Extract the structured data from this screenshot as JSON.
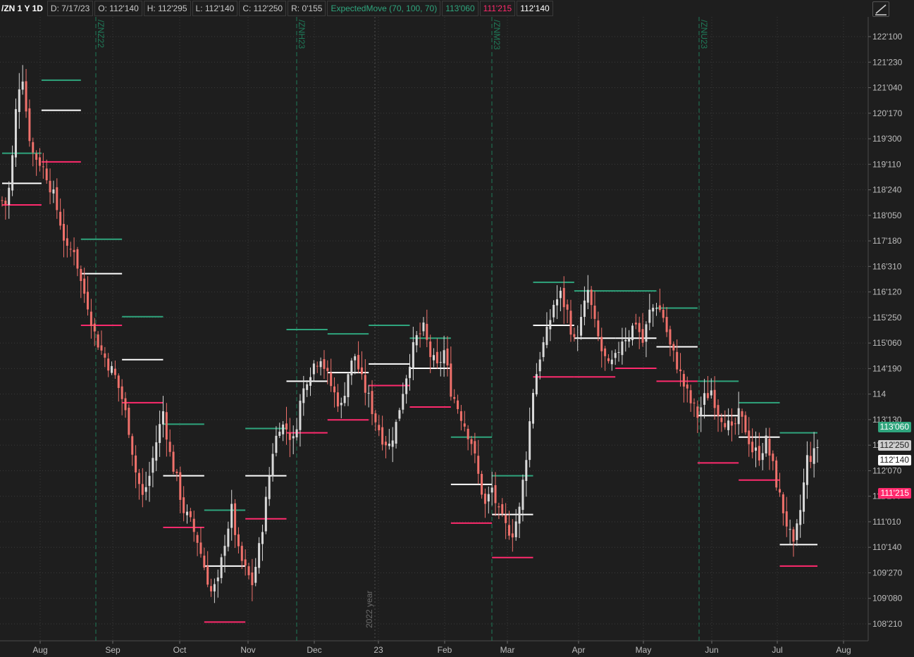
{
  "header": {
    "symbol": "/ZN 1 Y 1D",
    "date": "D: 7/17/23",
    "open": "O: 112'140",
    "high": "H: 112'295",
    "low": "L: 112'140",
    "close": "C: 112'250",
    "range": "R: 0'155",
    "study": "ExpectedMove (70, 100, 70)",
    "study_upper": "113'060",
    "study_lower": "111'215",
    "study_mid": "112'140"
  },
  "colors": {
    "background": "#1e1e1e",
    "grid": "#3a3a3a",
    "up_candle": "#d9d9d9",
    "down_candle": "#f0716b",
    "em_upper": "#2fa57d",
    "em_lower": "#ff2a6d",
    "em_mid": "#ffffff",
    "rollover_line": "#1f7a58"
  },
  "chart_data": {
    "type": "candlestick",
    "y_ticks": [
      "122'100",
      "121'230",
      "121'040",
      "120'170",
      "119'300",
      "119'110",
      "118'240",
      "118'050",
      "117'180",
      "116'310",
      "116'120",
      "115'250",
      "115'060",
      "114'190",
      "114",
      "113'130",
      "112'250",
      "112'070",
      "111'200",
      "111'010",
      "110'140",
      "109'270",
      "109'080",
      "108'210"
    ],
    "x_ticks": [
      "Aug",
      "Sep",
      "Oct",
      "Nov",
      "Dec",
      "23",
      "Feb",
      "Mar",
      "Apr",
      "May",
      "Jun",
      "Jul",
      "Aug"
    ],
    "rollovers": [
      "/ZNZ22",
      "/ZNH23",
      "/ZNM23",
      "/ZNU23"
    ],
    "year_marker": "2022 year",
    "price_tags": [
      {
        "label": "113'060",
        "kind": "em_upper"
      },
      {
        "label": "112'250",
        "kind": "close"
      },
      {
        "label": "112'140",
        "kind": "em_mid"
      },
      {
        "label": "111'215",
        "kind": "em_lower"
      }
    ],
    "anchors": [
      [
        0,
        118.5
      ],
      [
        3,
        118.4
      ],
      [
        6,
        119.5
      ],
      [
        9,
        121.1
      ],
      [
        12,
        121.4
      ],
      [
        15,
        120.2
      ],
      [
        18,
        119.6
      ],
      [
        22,
        119.4
      ],
      [
        26,
        119.1
      ],
      [
        30,
        118.6
      ],
      [
        34,
        118.0
      ],
      [
        38,
        117.3
      ],
      [
        42,
        117.4
      ],
      [
        46,
        116.6
      ],
      [
        50,
        116.1
      ],
      [
        54,
        115.4
      ],
      [
        58,
        115.0
      ],
      [
        62,
        114.7
      ],
      [
        66,
        114.4
      ],
      [
        70,
        113.9
      ],
      [
        74,
        113.2
      ],
      [
        78,
        112.2
      ],
      [
        82,
        111.6
      ],
      [
        86,
        112.1
      ],
      [
        90,
        112.9
      ],
      [
        94,
        113.6
      ],
      [
        98,
        112.6
      ],
      [
        102,
        112.0
      ],
      [
        106,
        111.3
      ],
      [
        110,
        111.0
      ],
      [
        114,
        110.6
      ],
      [
        118,
        110.0
      ],
      [
        122,
        109.4
      ],
      [
        126,
        109.6
      ],
      [
        130,
        110.6
      ],
      [
        134,
        111.3
      ],
      [
        138,
        110.3
      ],
      [
        142,
        109.9
      ],
      [
        146,
        109.6
      ],
      [
        150,
        110.4
      ],
      [
        154,
        111.5
      ],
      [
        158,
        112.7
      ],
      [
        162,
        113.3
      ],
      [
        166,
        113.2
      ],
      [
        170,
        112.9
      ],
      [
        174,
        113.8
      ],
      [
        178,
        114.4
      ],
      [
        182,
        114.7
      ],
      [
        186,
        114.9
      ],
      [
        190,
        114.4
      ],
      [
        194,
        114.0
      ],
      [
        198,
        113.7
      ],
      [
        202,
        114.5
      ],
      [
        206,
        114.9
      ],
      [
        210,
        114.3
      ],
      [
        214,
        113.9
      ],
      [
        218,
        113.4
      ],
      [
        222,
        113.0
      ],
      [
        226,
        112.8
      ],
      [
        230,
        113.3
      ],
      [
        234,
        114.1
      ],
      [
        238,
        114.8
      ],
      [
        242,
        115.3
      ],
      [
        246,
        115.5
      ],
      [
        250,
        114.9
      ],
      [
        254,
        114.6
      ],
      [
        258,
        115.0
      ],
      [
        262,
        114.1
      ],
      [
        266,
        113.7
      ],
      [
        270,
        113.3
      ],
      [
        274,
        112.9
      ],
      [
        278,
        112.1
      ],
      [
        282,
        111.4
      ],
      [
        286,
        111.8
      ],
      [
        290,
        111.2
      ],
      [
        294,
        110.9
      ],
      [
        298,
        110.8
      ],
      [
        302,
        111.3
      ],
      [
        306,
        112.6
      ],
      [
        310,
        114.1
      ],
      [
        314,
        114.9
      ],
      [
        318,
        115.4
      ],
      [
        322,
        116.1
      ],
      [
        326,
        116.3
      ],
      [
        330,
        115.9
      ],
      [
        334,
        115.2
      ],
      [
        338,
        115.7
      ],
      [
        342,
        116.4
      ],
      [
        346,
        115.6
      ],
      [
        350,
        115.0
      ],
      [
        354,
        114.6
      ],
      [
        358,
        114.8
      ],
      [
        362,
        115.3
      ],
      [
        366,
        115.4
      ],
      [
        370,
        115.7
      ],
      [
        374,
        115.2
      ],
      [
        378,
        115.9
      ],
      [
        382,
        116.1
      ],
      [
        386,
        115.8
      ],
      [
        390,
        115.1
      ],
      [
        394,
        114.7
      ],
      [
        398,
        114.2
      ],
      [
        402,
        113.8
      ],
      [
        406,
        113.5
      ],
      [
        410,
        113.9
      ],
      [
        414,
        114.1
      ],
      [
        418,
        113.6
      ],
      [
        422,
        113.4
      ],
      [
        426,
        113.1
      ],
      [
        430,
        113.5
      ],
      [
        434,
        113.2
      ],
      [
        438,
        112.7
      ],
      [
        442,
        112.6
      ],
      [
        446,
        112.9
      ],
      [
        450,
        112.3
      ],
      [
        454,
        111.6
      ],
      [
        458,
        111.0
      ],
      [
        462,
        110.4
      ],
      [
        466,
        111.3
      ],
      [
        470,
        112.5
      ],
      [
        474,
        112.6
      ],
      [
        476,
        112.8
      ]
    ],
    "contract_ranges": [
      {
        "start": 0,
        "end": 23,
        "upper": 119.6,
        "lower": 118.4,
        "mid": 118.9
      },
      {
        "start": 23,
        "end": 46,
        "upper": 121.3,
        "lower": 119.4,
        "mid": 120.6
      },
      {
        "start": 46,
        "end": 70,
        "upper": 117.6,
        "lower": 115.6,
        "mid": 116.8
      },
      {
        "start": 70,
        "end": 94,
        "upper": 115.8,
        "lower": 113.8,
        "mid": 114.8
      },
      {
        "start": 94,
        "end": 118,
        "upper": 113.3,
        "lower": 110.9,
        "mid": 112.1
      },
      {
        "start": 118,
        "end": 142,
        "upper": 111.3,
        "lower": 108.7,
        "mid": 110.0
      },
      {
        "start": 142,
        "end": 166,
        "upper": 113.2,
        "lower": 111.1,
        "mid": 112.1
      },
      {
        "start": 166,
        "end": 190,
        "upper": 115.5,
        "lower": 113.1,
        "mid": 114.3
      },
      {
        "start": 190,
        "end": 214,
        "upper": 115.4,
        "lower": 113.4,
        "mid": 114.5
      },
      {
        "start": 214,
        "end": 238,
        "upper": 115.6,
        "lower": 114.2,
        "mid": 114.7
      },
      {
        "start": 238,
        "end": 262,
        "upper": 115.3,
        "lower": 113.7,
        "mid": 114.6
      },
      {
        "start": 262,
        "end": 286,
        "upper": 113.0,
        "lower": 111.0,
        "mid": 111.9
      },
      {
        "start": 286,
        "end": 310,
        "upper": 112.1,
        "lower": 110.2,
        "mid": 111.2
      },
      {
        "start": 310,
        "end": 334,
        "upper": 116.6,
        "lower": 114.4,
        "mid": 115.6
      },
      {
        "start": 334,
        "end": 358,
        "upper": 116.4,
        "lower": 114.4,
        "mid": 115.3
      },
      {
        "start": 358,
        "end": 382,
        "upper": 116.4,
        "lower": 114.6,
        "mid": 115.3
      },
      {
        "start": 382,
        "end": 406,
        "upper": 116.0,
        "lower": 114.3,
        "mid": 115.1
      },
      {
        "start": 406,
        "end": 430,
        "upper": 114.3,
        "lower": 112.4,
        "mid": 113.5
      },
      {
        "start": 430,
        "end": 454,
        "upper": 113.8,
        "lower": 112.0,
        "mid": 113.0
      },
      {
        "start": 454,
        "end": 476,
        "upper": 113.1,
        "lower": 110.0,
        "mid": 110.5
      }
    ]
  }
}
